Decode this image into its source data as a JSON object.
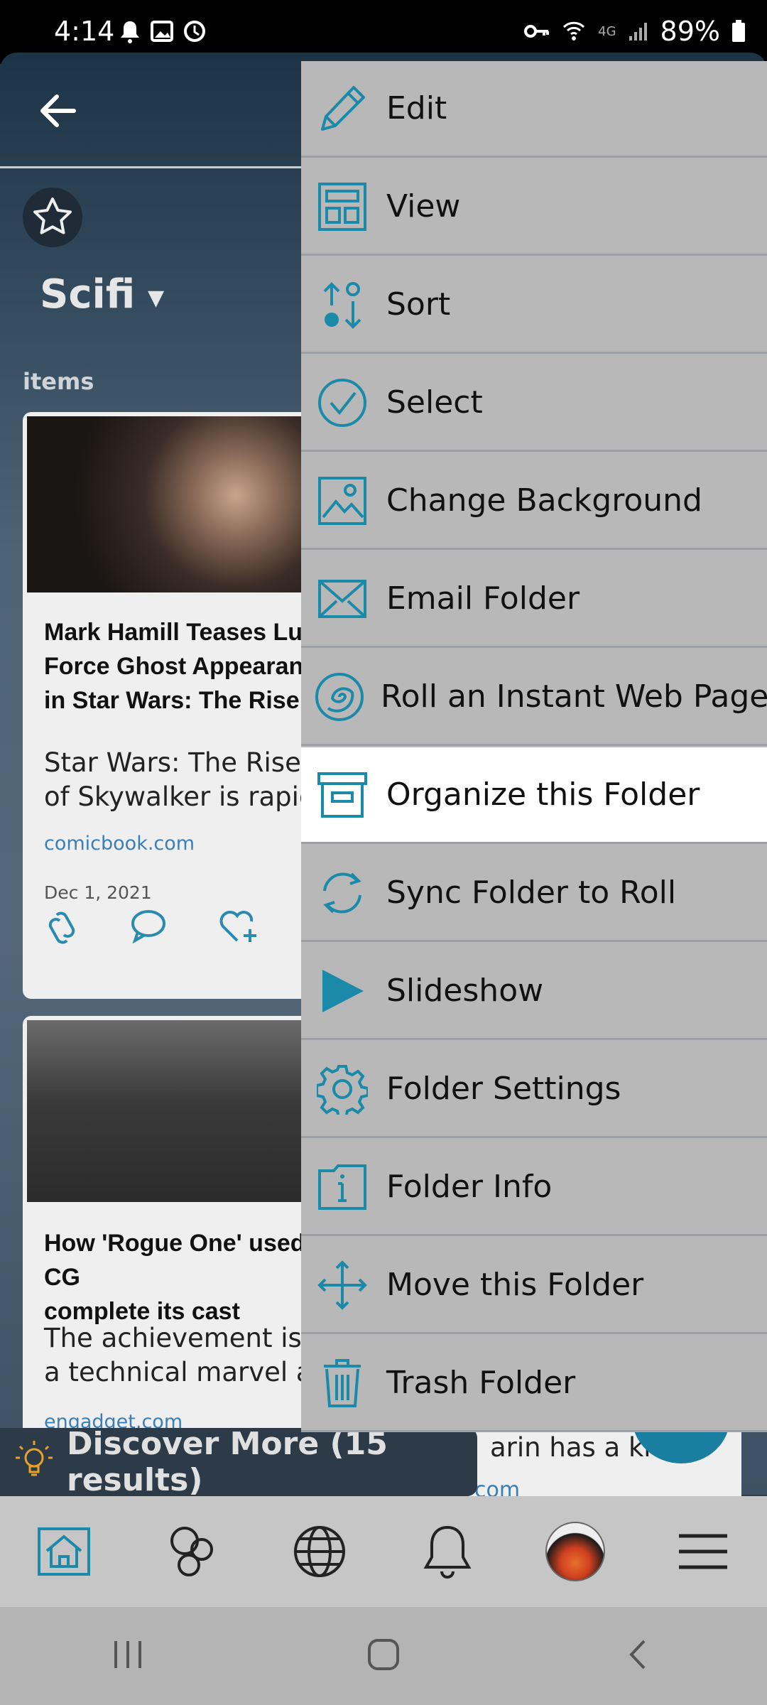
{
  "status_bar": {
    "time": "4:14",
    "network": "4G",
    "battery": "89%"
  },
  "folder": {
    "title": "Scifi",
    "items_label": "items"
  },
  "cards": [
    {
      "headline": "Mark Hamill Teases Luke\nForce Ghost Appearance\nin Star Wars: The Rise of",
      "summary": "Star Wars: The Rise\nof Skywalker is rapidl",
      "source": "comicbook.com",
      "date": "Dec 1, 2021"
    },
    {
      "headline": "How 'Rogue One' used CG\ncomplete its cast",
      "summary": "The achievement is b\na technical marvel an",
      "source": "engadget.com"
    }
  ],
  "behind_card": {
    "summary_fragment": "arin has a knac",
    "source_fragment": "com"
  },
  "discover": {
    "label": "Discover More (15 results)"
  },
  "menu": {
    "items": [
      {
        "label": "Edit",
        "icon": "pencil-icon"
      },
      {
        "label": "View",
        "icon": "layout-icon"
      },
      {
        "label": "Sort",
        "icon": "sort-icon"
      },
      {
        "label": "Select",
        "icon": "check-circle-icon"
      },
      {
        "label": "Change Background",
        "icon": "image-icon"
      },
      {
        "label": "Email Folder",
        "icon": "envelope-icon"
      },
      {
        "label": "Roll an Instant Web Page",
        "icon": "spiral-icon"
      },
      {
        "label": "Organize this Folder",
        "icon": "archive-box-icon"
      },
      {
        "label": "Sync Folder to Roll",
        "icon": "sync-icon"
      },
      {
        "label": "Slideshow",
        "icon": "play-icon"
      },
      {
        "label": "Folder Settings",
        "icon": "gear-icon"
      },
      {
        "label": "Folder Info",
        "icon": "info-icon"
      },
      {
        "label": "Move this Folder",
        "icon": "move-arrows-icon"
      },
      {
        "label": "Trash Folder",
        "icon": "trash-icon"
      }
    ],
    "highlighted": "Organize this Folder"
  },
  "colors": {
    "accent": "#1a8aa8",
    "menu_bg": "#b8b8b8",
    "highlight_bg": "#ffffff"
  }
}
